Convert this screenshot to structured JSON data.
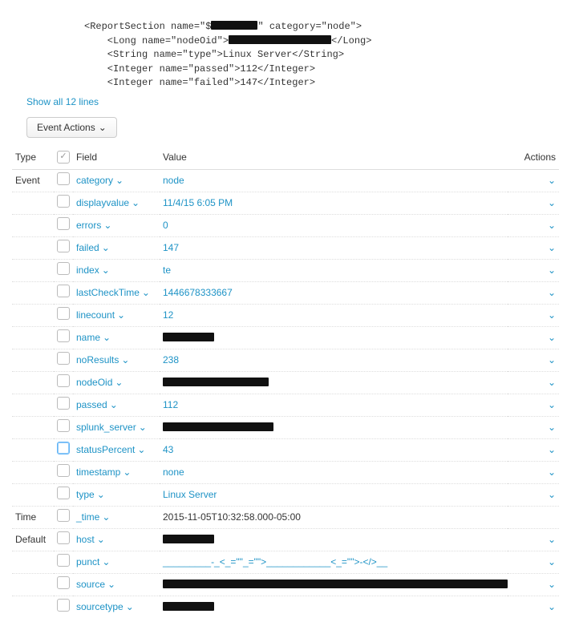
{
  "raw_event": {
    "l1_pre": "<ReportSection name=\"$",
    "l1_red_w": 58,
    "l1_post": "\" category=\"node\">",
    "l2_pre": "    <Long name=\"nodeOid\">",
    "l2_red_w": 128,
    "l2_post": "</Long>",
    "l3": "    <String name=\"type\">Linux Server</String>",
    "l4": "    <Integer name=\"passed\">112</Integer>",
    "l5": "    <Integer name=\"failed\">147</Integer>"
  },
  "show_all_label": "Show all 12 lines",
  "event_actions_label": "Event Actions",
  "headers": {
    "type": "Type",
    "field": "Field",
    "value": "Value",
    "actions": "Actions"
  },
  "groups": {
    "event": "Event",
    "time": "Time",
    "default": "Default"
  },
  "rows": [
    {
      "grp": "event",
      "field": "category",
      "val": "node",
      "link": true
    },
    {
      "grp": "event",
      "field": "displayvalue",
      "val": "11/4/15 6:05 PM",
      "link": true
    },
    {
      "grp": "event",
      "field": "errors",
      "val": "0",
      "link": true
    },
    {
      "grp": "event",
      "field": "failed",
      "val": "147",
      "link": true
    },
    {
      "grp": "event",
      "field": "index",
      "val": "te",
      "link": true
    },
    {
      "grp": "event",
      "field": "lastCheckTime",
      "val": "1446678333667",
      "link": true
    },
    {
      "grp": "event",
      "field": "linecount",
      "val": "12",
      "link": true
    },
    {
      "grp": "event",
      "field": "name",
      "redact": 64
    },
    {
      "grp": "event",
      "field": "noResults",
      "val": "238",
      "link": true
    },
    {
      "grp": "event",
      "field": "nodeOid",
      "redact": 132
    },
    {
      "grp": "event",
      "field": "passed",
      "val": "112",
      "link": true
    },
    {
      "grp": "event",
      "field": "splunk_server",
      "redact": 138
    },
    {
      "grp": "event",
      "field": "statusPercent",
      "val": "43",
      "link": true,
      "focus": true
    },
    {
      "grp": "event",
      "field": "timestamp",
      "val": "none",
      "link": true
    },
    {
      "grp": "event",
      "field": "type",
      "val": "Linux Server",
      "link": true
    },
    {
      "grp": "time",
      "field": "_time",
      "val": "2015-11-05T10:32:58.000-05:00",
      "link": false,
      "noaction": true
    },
    {
      "grp": "default",
      "field": "host",
      "redact": 64
    },
    {
      "grp": "default",
      "field": "punct",
      "val": "_________-_<_=\"\"_=\"\">____________<_=\"\">-</>__",
      "link": true
    },
    {
      "grp": "default",
      "field": "source",
      "redact": 430
    },
    {
      "grp": "default",
      "field": "sourcetype",
      "redact": 64
    }
  ]
}
